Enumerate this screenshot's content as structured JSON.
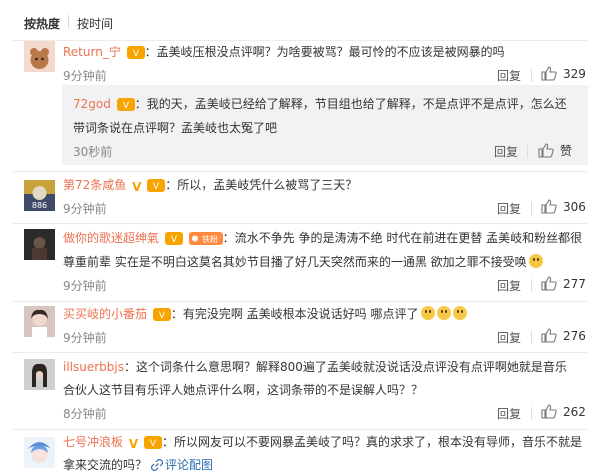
{
  "sort": {
    "hot": "按热度",
    "time": "按时间"
  },
  "comments": [
    {
      "user": "Return_宁",
      "text": "孟美岐压根没点评啊？为啥要被骂？最可怜的不应该是被网暴的吗",
      "time": "9分钟前",
      "reply": "回复",
      "likes": "329",
      "sub": {
        "user": "72god",
        "line1": "我的天，孟美岐已经给了解释，节目组也给了解释，不是点评不是点评，怎么还",
        "line2": "带词条说在点评啊？孟美岐也太冤了吧",
        "time": "30秒前",
        "reply": "回复",
        "likes": "赞"
      }
    },
    {
      "user": "第72条咸鱼",
      "text": "所以，孟美岐凭什么被骂了三天？",
      "time": "9分钟前",
      "reply": "回复",
      "likes": "306",
      "avatar_label": "886"
    },
    {
      "user": "做你的歌迷超绅氣",
      "badge": "铁粉",
      "line1": "流水不争先 争的是涛涛不绝 时代在前进在更替 孟美岐和粉丝都很",
      "line2": "尊重前辈 实在是不明白这莫名其妙节目播了好几天突然而来的一通黑 欲加之罪不接受唤",
      "time": "9分钟前",
      "reply": "回复",
      "likes": "277"
    },
    {
      "user": "买买岐的小番茄",
      "text": "有完没完啊 孟美岐根本没说话好吗 哪点评了",
      "time": "9分钟前",
      "reply": "回复",
      "likes": "276"
    },
    {
      "user": "illsuerbbjs",
      "line1": "这个词条什么意思啊？解释800遍了孟美岐就没说话没点评没有点评啊她就是音乐",
      "line2": "合伙人这节目有乐评人她点评什么啊，这词条带的不是误解人吗？？",
      "time": "8分钟前",
      "reply": "回复",
      "likes": "262"
    },
    {
      "user": "七号冲浪板",
      "line1": "所以网友可以不要网暴孟美岐了吗？真的求求了，根本没有导师，音乐不就是",
      "line2": "拿来交流的吗？",
      "link": "评论配图"
    }
  ],
  "colors": {
    "username": "#eb7350",
    "vip": "#f7a300",
    "link": "#2a6cb1",
    "meta": "#888888"
  }
}
